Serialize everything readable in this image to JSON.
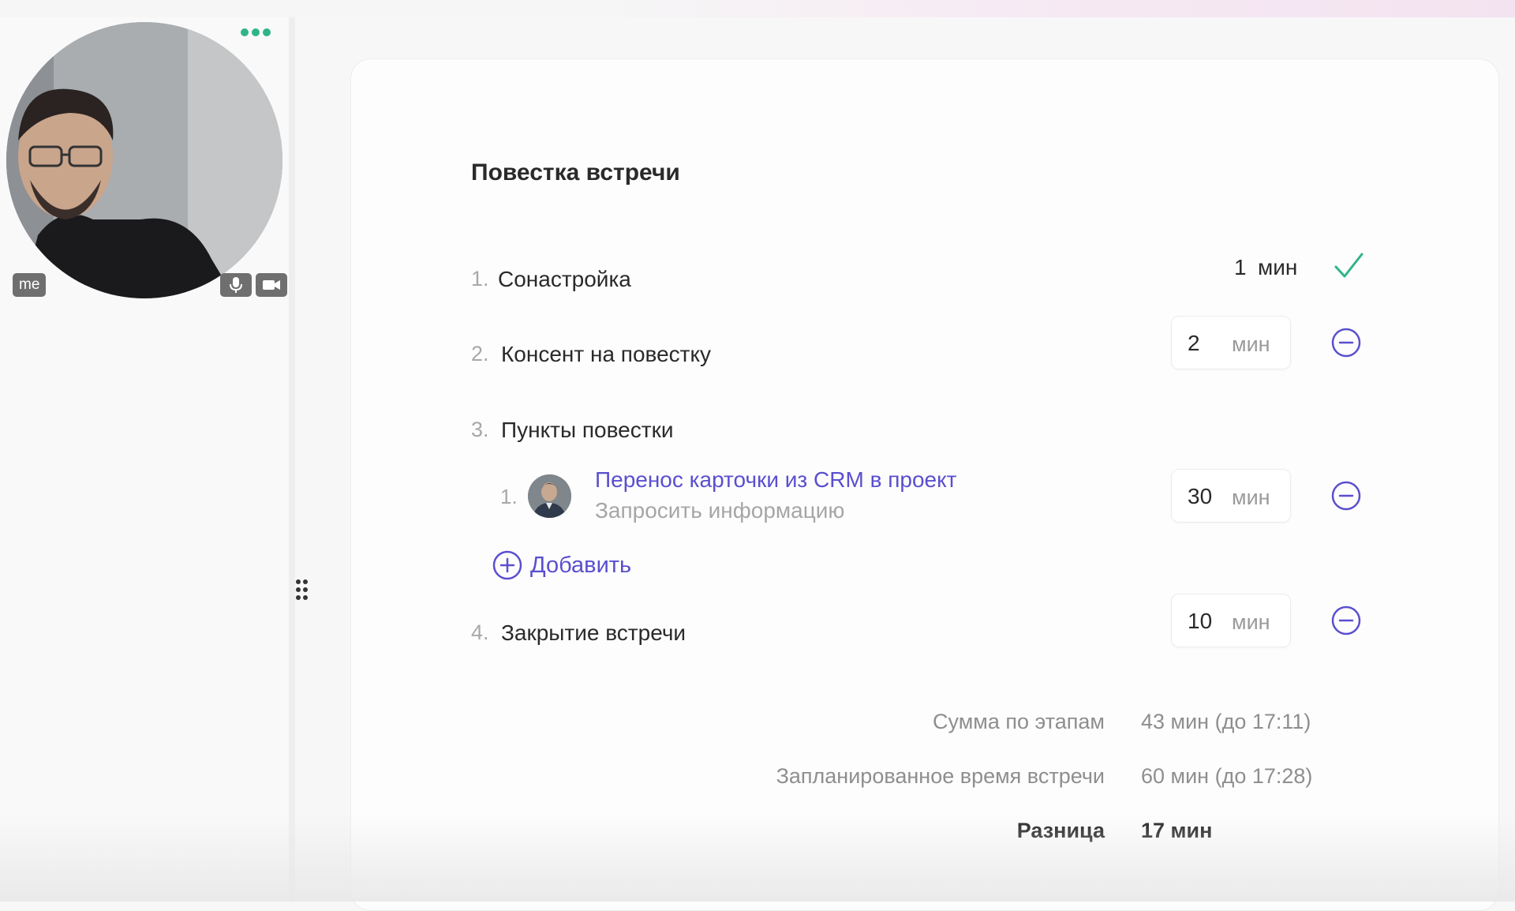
{
  "participant": {
    "name_badge": "me",
    "more_icon": "more-dots-icon",
    "mic_icon": "microphone-icon",
    "camera_icon": "camera-icon"
  },
  "agenda": {
    "title": "Повестка встречи",
    "unit": "мин",
    "items": [
      {
        "num": "1.",
        "label": "Сонастройка",
        "minutes": "1",
        "status": "done"
      },
      {
        "num": "2.",
        "label": "Консент на повестку",
        "minutes": "2"
      },
      {
        "num": "3.",
        "label": "Пункты повестки"
      },
      {
        "num": "4.",
        "label": "Закрытие встречи",
        "minutes": "10"
      }
    ],
    "subitems": [
      {
        "num": "1.",
        "title": "Перенос карточки из CRM в проект",
        "subtitle": "Запросить информацию",
        "minutes": "30"
      }
    ],
    "add_label": "Добавить"
  },
  "summary": {
    "total_label": "Сумма по этапам",
    "total_value": "43 мин (до 17:11)",
    "planned_label": "Запланированное время встречи",
    "planned_value": "60 мин (до 17:28)",
    "diff_label": "Разница",
    "diff_value": "17 мин"
  },
  "colors": {
    "accent": "#5a4fcf",
    "success": "#2fb585",
    "muted": "#9a9a9a"
  }
}
